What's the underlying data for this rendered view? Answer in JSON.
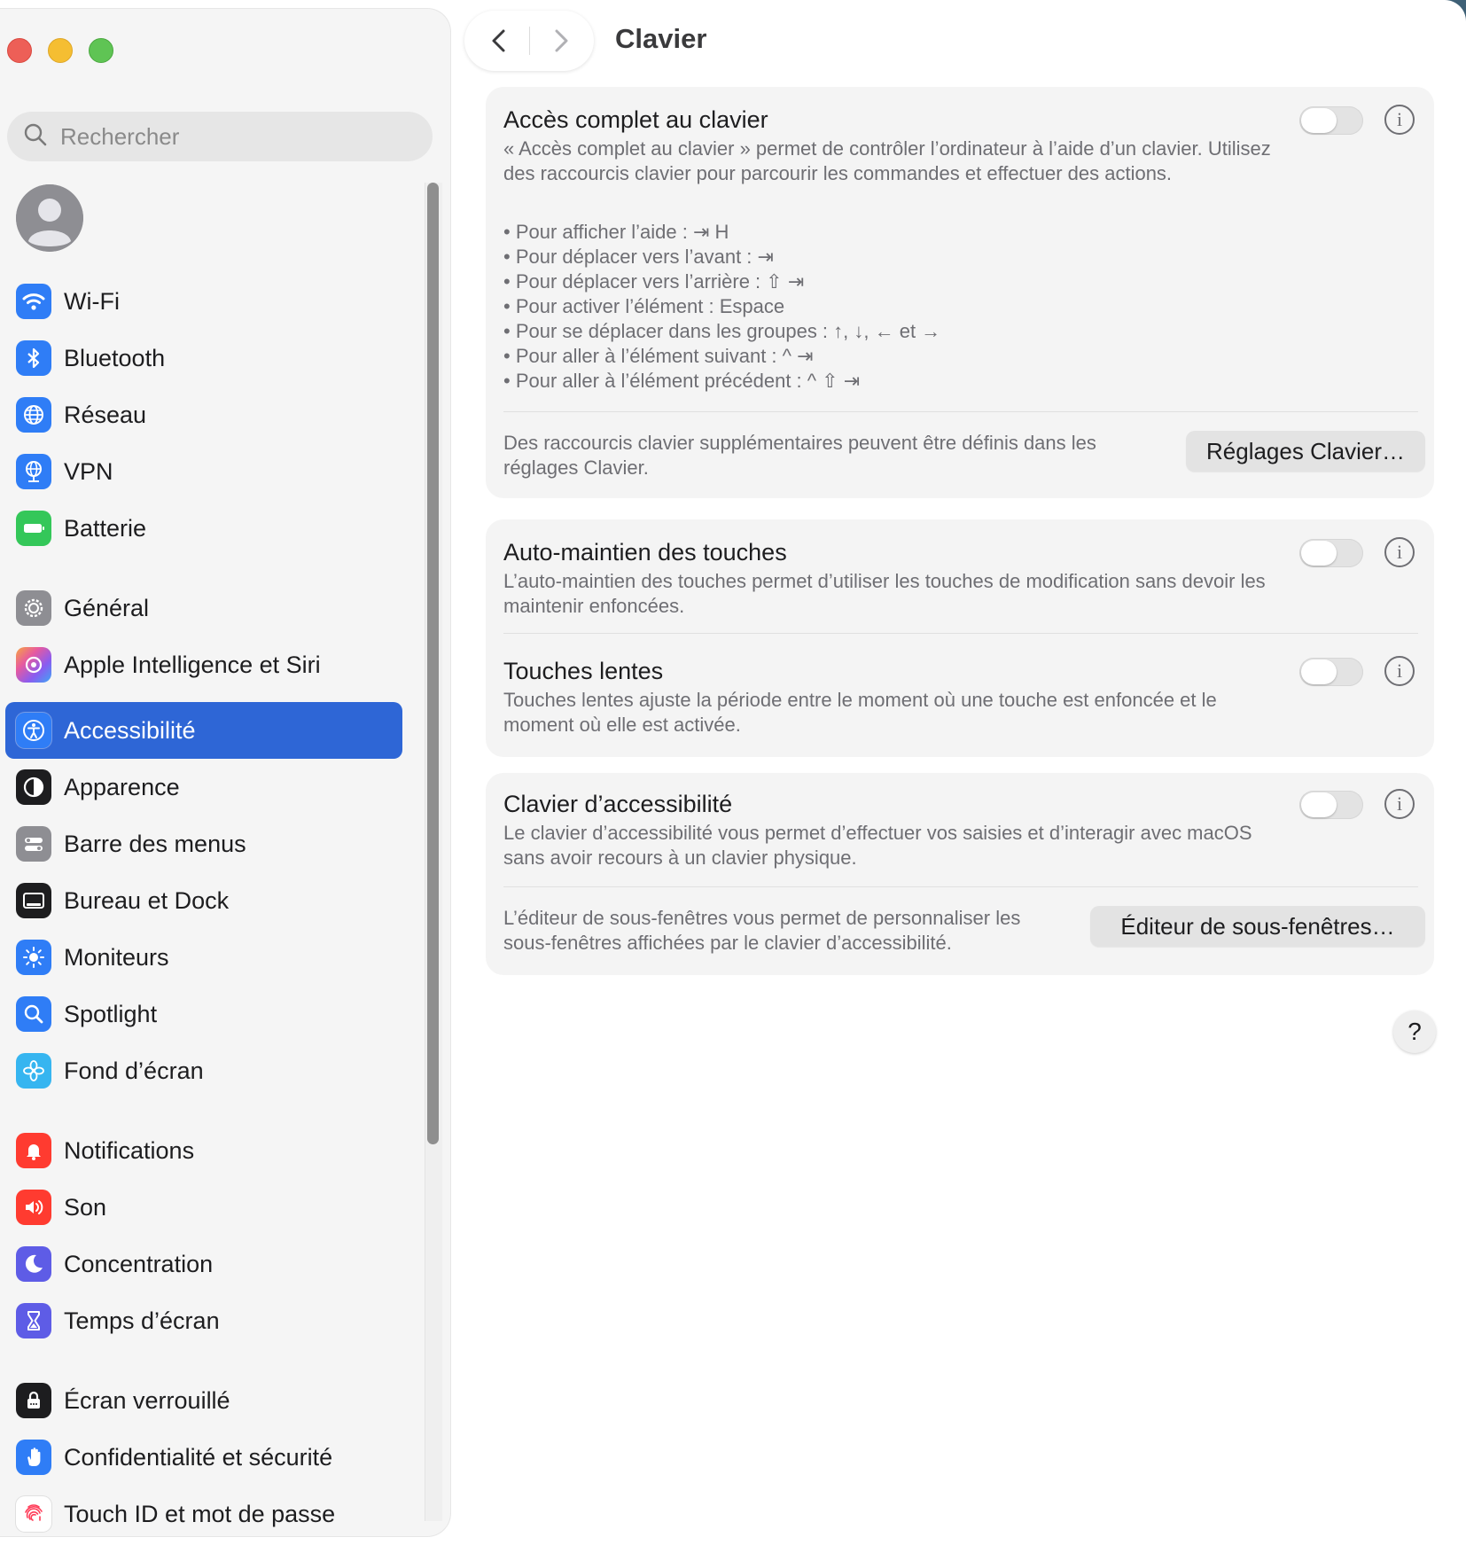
{
  "window": {
    "title": "Clavier"
  },
  "sidebar": {
    "search_placeholder": "Rechercher",
    "items": [
      {
        "label": "Wi-Fi",
        "icon": "wifi-icon",
        "color": "#2f7df6"
      },
      {
        "label": "Bluetooth",
        "icon": "bluetooth-icon",
        "color": "#2f7df6"
      },
      {
        "label": "Réseau",
        "icon": "globe-icon",
        "color": "#2f7df6"
      },
      {
        "label": "VPN",
        "icon": "vpn-globe-icon",
        "color": "#2f7df6"
      },
      {
        "label": "Batterie",
        "icon": "battery-icon",
        "color": "#34c759"
      },
      {
        "label": "Général",
        "icon": "gear-icon",
        "color": "#8e8e93"
      },
      {
        "label": "Apple Intelligence et Siri",
        "icon": "siri-icon",
        "color": "#c86dd7"
      },
      {
        "label": "Accessibilité",
        "icon": "accessibility-icon",
        "color": "#2f7df6",
        "active": true
      },
      {
        "label": "Apparence",
        "icon": "appearance-icon",
        "color": "#1d1d1f"
      },
      {
        "label": "Barre des menus",
        "icon": "menubar-icon",
        "color": "#8e8e93"
      },
      {
        "label": "Bureau et Dock",
        "icon": "dock-icon",
        "color": "#1d1d1f"
      },
      {
        "label": "Moniteurs",
        "icon": "sun-icon",
        "color": "#2f7df6"
      },
      {
        "label": "Spotlight",
        "icon": "magnifier-icon",
        "color": "#2f7df6"
      },
      {
        "label": "Fond d’écran",
        "icon": "flower-icon",
        "color": "#36b5f0"
      },
      {
        "label": "Notifications",
        "icon": "bell-icon",
        "color": "#ff3b30"
      },
      {
        "label": "Son",
        "icon": "speaker-icon",
        "color": "#ff3b30"
      },
      {
        "label": "Concentration",
        "icon": "moon-icon",
        "color": "#5e5ce6"
      },
      {
        "label": "Temps d’écran",
        "icon": "hourglass-icon",
        "color": "#5e5ce6"
      },
      {
        "label": "Écran verrouillé",
        "icon": "lock-icon",
        "color": "#1d1d1f"
      },
      {
        "label": "Confidentialité et sécurité",
        "icon": "hand-icon",
        "color": "#2f7df6"
      },
      {
        "label": "Touch ID et mot de passe",
        "icon": "fingerprint-icon",
        "color": "#ffffff"
      }
    ]
  },
  "content": {
    "full_keyboard": {
      "title": "Accès complet au clavier",
      "description": "« Accès complet au clavier » permet de contrôler l’ordinateur à l’aide d’un clavier. Utilisez des raccourcis clavier pour parcourir les commandes et effectuer des actions.",
      "bullets": [
        "Pour afficher l’aide : ⇥ H",
        "Pour déplacer vers l’avant : ⇥",
        "Pour déplacer vers l’arrière : ⇧ ⇥",
        "Pour activer l’élément : Espace",
        "Pour se déplacer dans les groupes : ↑, ↓, ← et →",
        "Pour aller à l’élément suivant : ^ ⇥",
        "Pour aller à l’élément précédent : ^ ⇧ ⇥"
      ],
      "footer_text": "Des raccourcis clavier supplémentaires peuvent être définis dans les réglages Clavier.",
      "button": "Réglages Clavier…",
      "enabled": false
    },
    "sticky_keys": {
      "title": "Auto-maintien des touches",
      "description": "L’auto-maintien des touches permet d’utiliser les touches de modification sans devoir les maintenir enfoncées.",
      "enabled": false
    },
    "slow_keys": {
      "title": "Touches lentes",
      "description": "Touches lentes ajuste la période entre le moment où une touche est enfoncée et le moment où elle est activée.",
      "enabled": false
    },
    "accessibility_keyboard": {
      "title": "Clavier d’accessibilité",
      "description": "Le clavier d’accessibilité vous permet d’effectuer vos saisies et d’interagir avec macOS sans avoir recours à un clavier physique.",
      "footer_text": "L’éditeur de sous-fenêtres vous permet de personnaliser les sous-fenêtres affichées par le clavier d’accessibilité.",
      "button": "Éditeur de sous-fenêtres…",
      "enabled": false
    },
    "help": "?"
  }
}
